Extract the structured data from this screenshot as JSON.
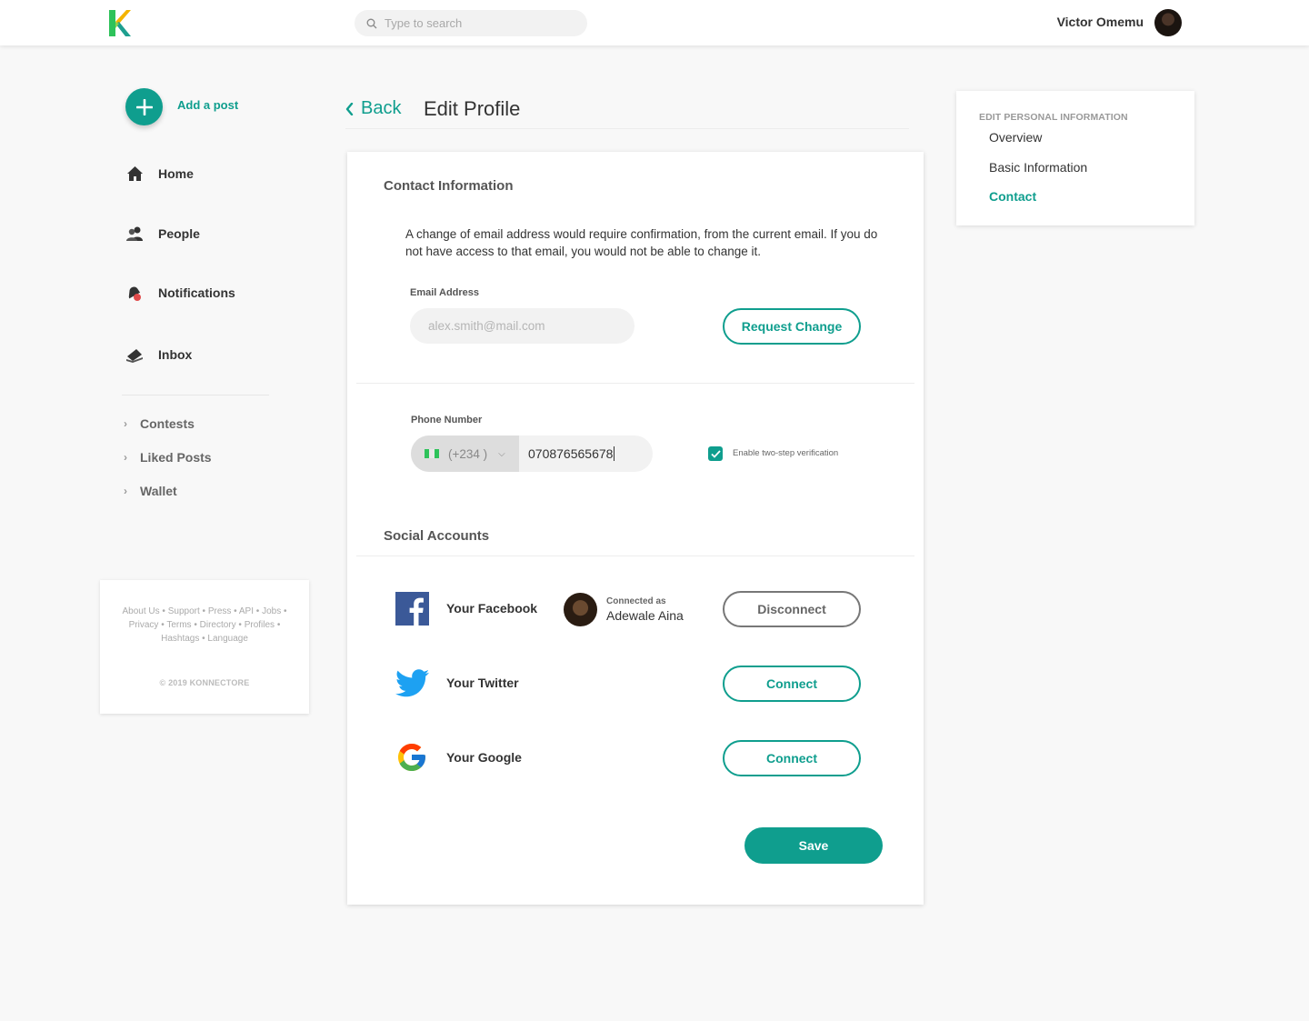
{
  "header": {
    "search_placeholder": "Type to search",
    "user_name": "Victor Omemu"
  },
  "sidebar": {
    "add_post": "Add a post",
    "nav": [
      {
        "label": "Home",
        "icon": "home-icon"
      },
      {
        "label": "People",
        "icon": "people-icon"
      },
      {
        "label": "Notifications",
        "icon": "notification-icon"
      },
      {
        "label": "Inbox",
        "icon": "inbox-icon"
      }
    ],
    "sub": [
      "Contests",
      "Liked Posts",
      "Wallet"
    ],
    "footer_links": [
      "About Us",
      "Support",
      "Press",
      "API",
      "Jobs",
      "Privacy",
      "Terms",
      "Directory",
      "Profiles",
      "Hashtags",
      "Language"
    ],
    "copyright": "© 2019 KONNECTORE"
  },
  "page": {
    "back": "Back",
    "title": "Edit Profile"
  },
  "contact": {
    "title": "Contact Information",
    "note": "A change of email address would require confirmation, from the current email. If you do not have access to that email, you would not be able to change it.",
    "email_label": "Email Address",
    "email_placeholder": "alex.smith@mail.com",
    "request_change": "Request Change",
    "phone_label": "Phone Number",
    "country_code": "(+234 )",
    "phone_value": "070876565678",
    "two_step_label": "Enable two-step verification",
    "two_step_checked": true
  },
  "social": {
    "title": "Social Accounts",
    "facebook": {
      "label": "Your Facebook",
      "connected_as": "Connected as",
      "name": "Adewale Aina",
      "button": "Disconnect"
    },
    "twitter": {
      "label": "Your Twitter",
      "button": "Connect"
    },
    "google": {
      "label": "Your Google",
      "button": "Connect"
    }
  },
  "save": "Save",
  "right_panel": {
    "heading": "EDIT PERSONAL INFORMATION",
    "links": [
      "Overview",
      "Basic Information",
      "Contact"
    ],
    "active": "Contact"
  },
  "colors": {
    "accent": "#0f9e8e",
    "facebook": "#3b5998",
    "twitter": "#1da1f2"
  }
}
